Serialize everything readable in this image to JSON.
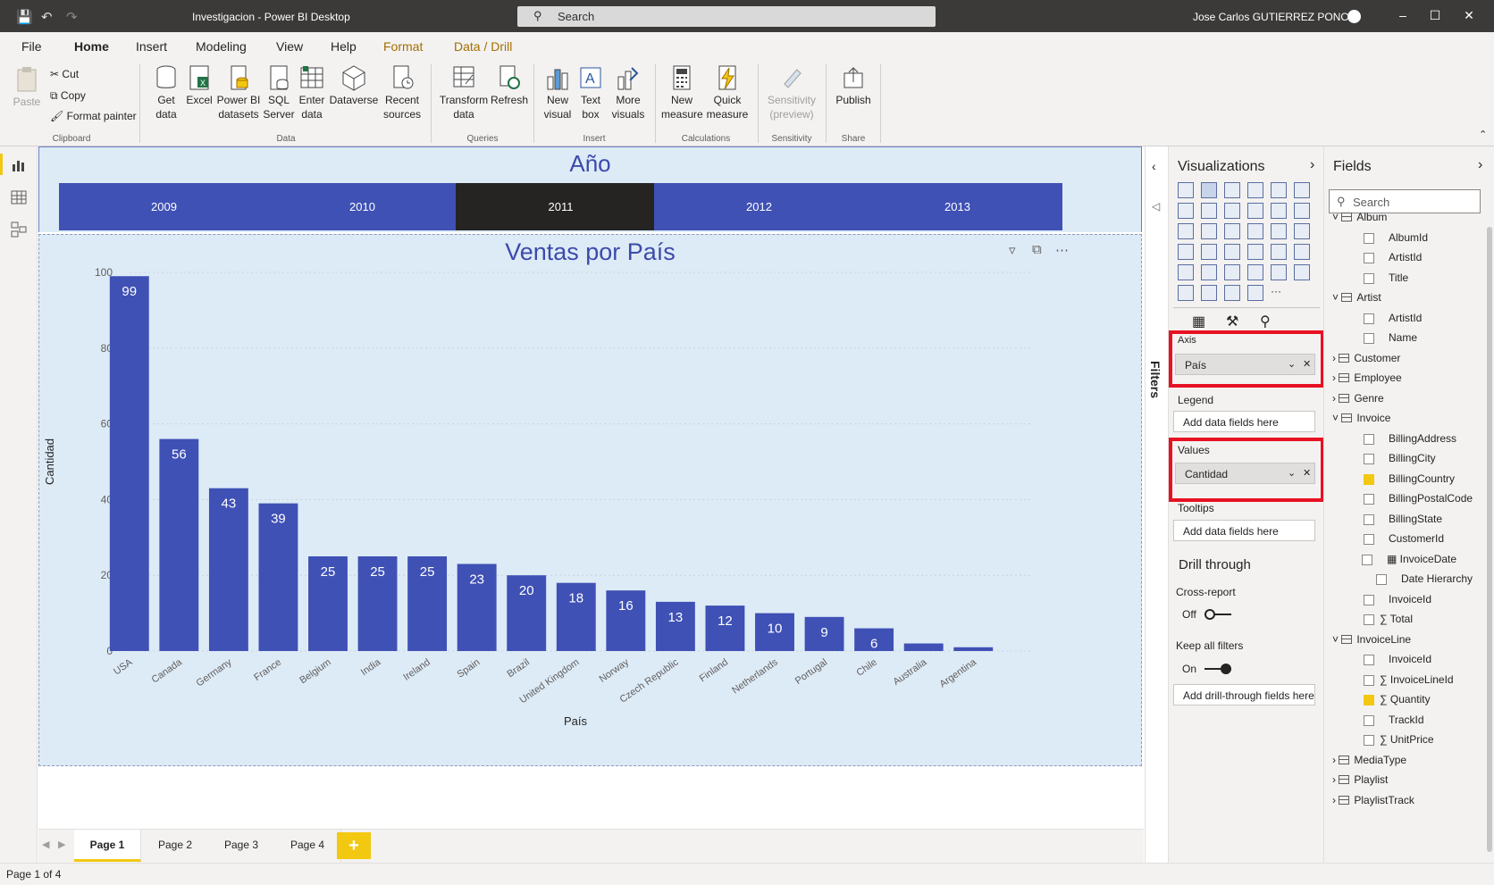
{
  "titlebar": {
    "app_title": "Investigacion - Power BI Desktop",
    "search_label": "Search",
    "user_name": "Jose Carlos GUTIERREZ PONCE"
  },
  "tabs": [
    "File",
    "Home",
    "Insert",
    "Modeling",
    "View",
    "Help",
    "Format",
    "Data / Drill"
  ],
  "ribbon": {
    "paste": "Paste",
    "cut": "Cut",
    "copy": "Copy",
    "format_painter": "Format painter",
    "clipboard_group": "Clipboard",
    "get_data": "Get data",
    "excel": "Excel",
    "pbi_datasets": "Power BI datasets",
    "sql_server": "SQL Server",
    "enter_data": "Enter data",
    "dataverse": "Dataverse",
    "recent_sources": "Recent sources",
    "data_group": "Data",
    "transform_data": "Transform data",
    "refresh": "Refresh",
    "queries_group": "Queries",
    "new_visual": "New visual",
    "text_box": "Text box",
    "more_visuals": "More visuals",
    "insert_group": "Insert",
    "new_measure": "New measure",
    "quick_measure": "Quick measure",
    "calculations_group": "Calculations",
    "sensitivity": "Sensitivity (preview)",
    "sensitivity_group": "Sensitivity",
    "publish": "Publish",
    "share_group": "Share"
  },
  "slicer": {
    "title": "Año",
    "years": [
      "2009",
      "2010",
      "2011",
      "2012",
      "2013"
    ],
    "selected": "2011"
  },
  "chart_data": {
    "type": "bar",
    "title": "Ventas por País",
    "xlabel": "País",
    "ylabel": "Cantidad",
    "ylim": [
      0,
      100
    ],
    "yticks": [
      0,
      20,
      40,
      60,
      80,
      100
    ],
    "categories": [
      "USA",
      "Canada",
      "Germany",
      "France",
      "Belgium",
      "India",
      "Ireland",
      "Spain",
      "Brazil",
      "United Kingdom",
      "Norway",
      "Czech Republic",
      "Finland",
      "Netherlands",
      "Portugal",
      "Chile",
      "Australia",
      "Argentina"
    ],
    "values": [
      99,
      56,
      43,
      39,
      25,
      25,
      25,
      23,
      20,
      18,
      16,
      13,
      12,
      10,
      9,
      6,
      2,
      1
    ],
    "data_labels": [
      "99",
      "56",
      "43",
      "39",
      "25",
      "25",
      "25",
      "23",
      "20",
      "18",
      "16",
      "13",
      "12",
      "10",
      "9",
      "6",
      "",
      ""
    ],
    "bar_color": "#3f51b5",
    "grid": true
  },
  "pages": [
    "Page 1",
    "Page 2",
    "Page 3",
    "Page 4"
  ],
  "active_page": "Page 1",
  "status": "Page 1 of 4",
  "filters_label": "Filters",
  "viz": {
    "title": "Visualizations",
    "axis_label": "Axis",
    "axis_value": "País",
    "legend_label": "Legend",
    "legend_placeholder": "Add data fields here",
    "values_label": "Values",
    "values_value": "Cantidad",
    "tooltips_label": "Tooltips",
    "tooltips_placeholder": "Add data fields here",
    "drill_title": "Drill through",
    "cross_report": "Cross-report",
    "cross_state": "Off",
    "keep_filters": "Keep all filters",
    "keep_state": "On",
    "drill_placeholder": "Add drill-through fields here"
  },
  "fields": {
    "title": "Fields",
    "search_placeholder": "Search",
    "items": [
      {
        "label": "Album",
        "kind": "table",
        "expanded": true
      },
      {
        "label": "AlbumId",
        "kind": "field",
        "checked": false
      },
      {
        "label": "ArtistId",
        "kind": "field",
        "checked": false
      },
      {
        "label": "Title",
        "kind": "field",
        "checked": false
      },
      {
        "label": "Artist",
        "kind": "table",
        "expanded": true
      },
      {
        "label": "ArtistId",
        "kind": "field",
        "checked": false
      },
      {
        "label": "Name",
        "kind": "field",
        "checked": false
      },
      {
        "label": "Customer",
        "kind": "table",
        "expanded": false
      },
      {
        "label": "Employee",
        "kind": "table",
        "expanded": false
      },
      {
        "label": "Genre",
        "kind": "table",
        "expanded": false
      },
      {
        "label": "Invoice",
        "kind": "table",
        "expanded": true
      },
      {
        "label": "BillingAddress",
        "kind": "field",
        "checked": false
      },
      {
        "label": "BillingCity",
        "kind": "field",
        "checked": false
      },
      {
        "label": "BillingCountry",
        "kind": "field",
        "checked": true
      },
      {
        "label": "BillingPostalCode",
        "kind": "field",
        "checked": false
      },
      {
        "label": "BillingState",
        "kind": "field",
        "checked": false
      },
      {
        "label": "CustomerId",
        "kind": "field",
        "checked": false
      },
      {
        "label": "InvoiceDate",
        "kind": "datefield",
        "checked": false
      },
      {
        "label": "Date Hierarchy",
        "kind": "hier",
        "checked": false
      },
      {
        "label": "InvoiceId",
        "kind": "field",
        "checked": false
      },
      {
        "label": "Total",
        "kind": "sum",
        "checked": false
      },
      {
        "label": "InvoiceLine",
        "kind": "table",
        "expanded": true
      },
      {
        "label": "InvoiceId",
        "kind": "field",
        "checked": false
      },
      {
        "label": "InvoiceLineId",
        "kind": "sum",
        "checked": false
      },
      {
        "label": "Quantity",
        "kind": "sum",
        "checked": true
      },
      {
        "label": "TrackId",
        "kind": "field",
        "checked": false
      },
      {
        "label": "UnitPrice",
        "kind": "sum",
        "checked": false
      },
      {
        "label": "MediaType",
        "kind": "table",
        "expanded": false
      },
      {
        "label": "Playlist",
        "kind": "table",
        "expanded": false
      },
      {
        "label": "PlaylistTrack",
        "kind": "table",
        "expanded": false
      }
    ]
  }
}
